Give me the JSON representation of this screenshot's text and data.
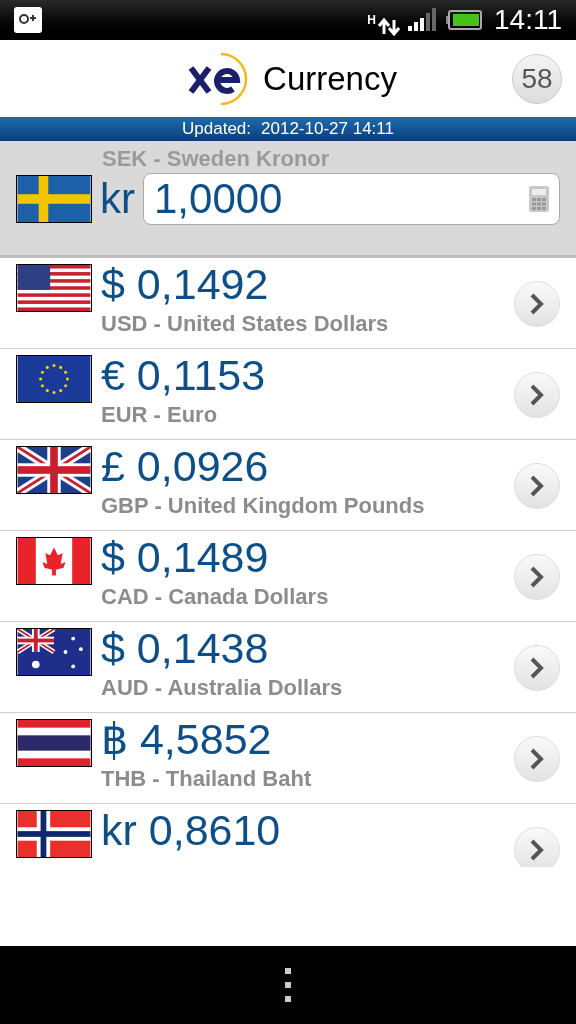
{
  "status_bar": {
    "network": "H",
    "time": "14:11"
  },
  "header": {
    "title": "Currency",
    "badge": "58"
  },
  "updated": {
    "label": "Updated:",
    "value": "2012-10-27 14:11"
  },
  "base": {
    "kind": "se",
    "name": "SEK - Sweden Kronor",
    "symbol": "kr",
    "value": "1,0000"
  },
  "rows": [
    {
      "kind": "us",
      "amount": "$ 0,1492",
      "name": "USD - United States Dollars"
    },
    {
      "kind": "eu",
      "amount": "€ 0,1153",
      "name": "EUR - Euro"
    },
    {
      "kind": "gb",
      "amount": "£ 0,0926",
      "name": "GBP - United Kingdom Pounds"
    },
    {
      "kind": "ca",
      "amount": "$ 0,1489",
      "name": "CAD - Canada Dollars"
    },
    {
      "kind": "au",
      "amount": "$ 0,1438",
      "name": "AUD - Australia Dollars"
    },
    {
      "kind": "th",
      "amount": "฿ 4,5852",
      "name": "THB - Thailand Baht"
    },
    {
      "kind": "no",
      "amount": "kr 0,8610"
    }
  ]
}
